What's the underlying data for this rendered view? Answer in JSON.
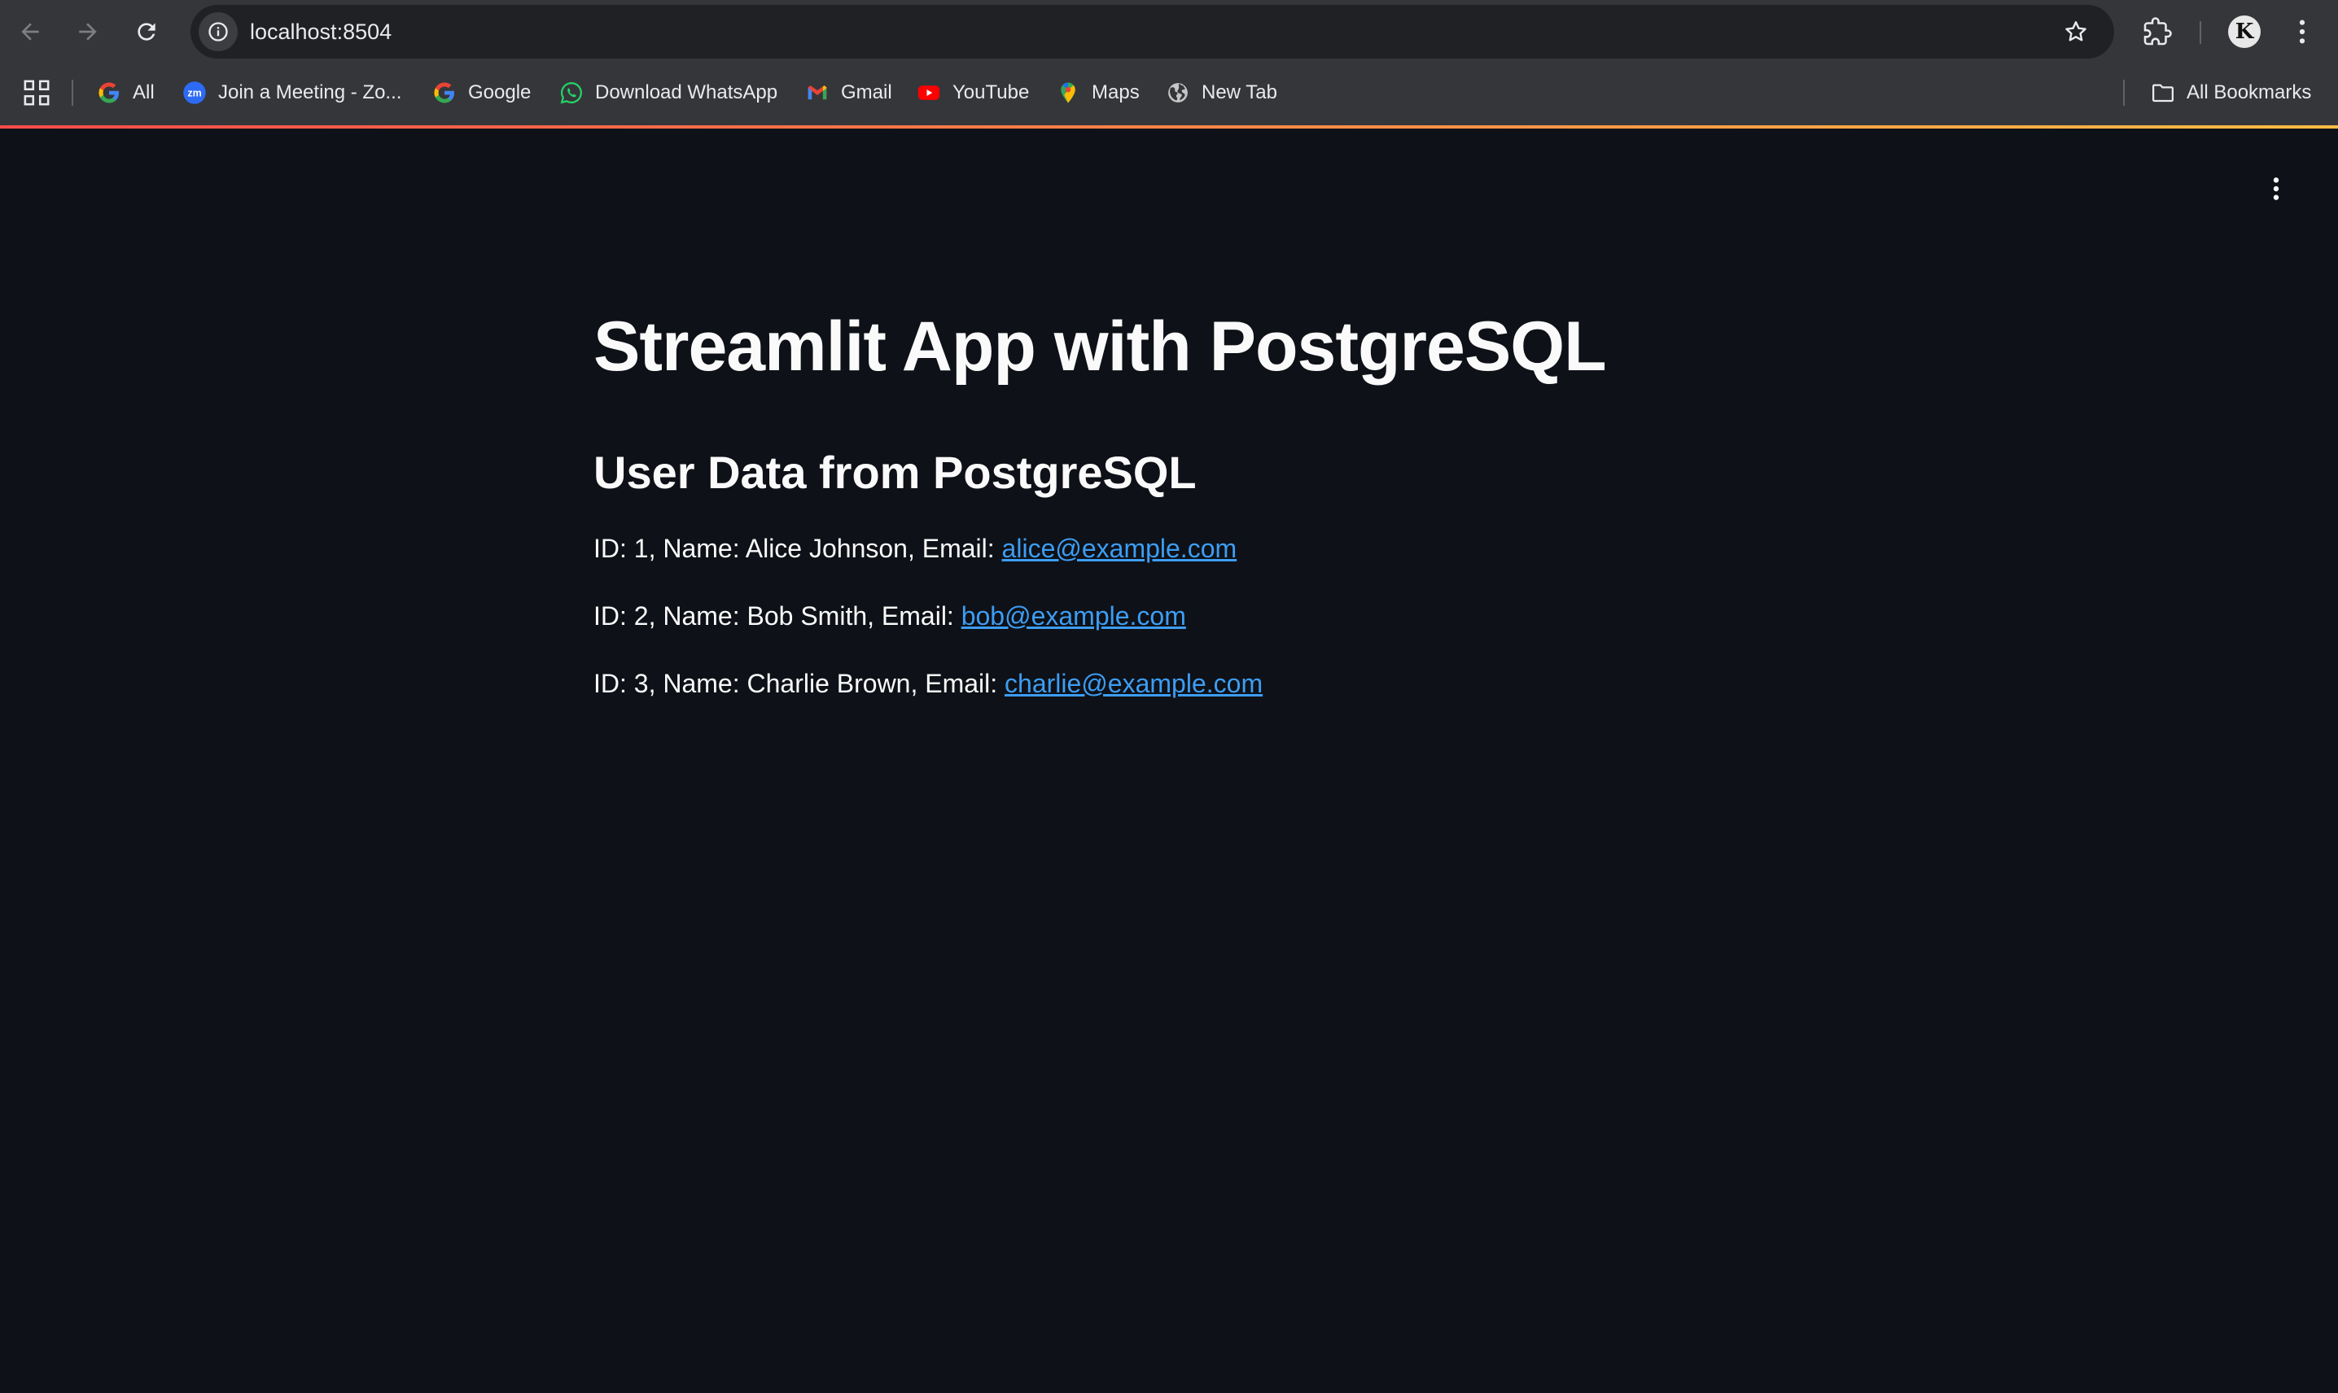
{
  "browser": {
    "url": "localhost:8504",
    "bookmarks": [
      {
        "label": "All",
        "icon": "google-icon"
      },
      {
        "label": "Join a Meeting - Zo...",
        "icon": "zoom-icon"
      },
      {
        "label": "Google",
        "icon": "google-icon"
      },
      {
        "label": "Download WhatsApp",
        "icon": "whatsapp-icon"
      },
      {
        "label": "Gmail",
        "icon": "gmail-icon"
      },
      {
        "label": "YouTube",
        "icon": "youtube-icon"
      },
      {
        "label": "Maps",
        "icon": "maps-pin-icon"
      },
      {
        "label": "New Tab",
        "icon": "globe-icon"
      }
    ],
    "all_bookmarks_label": "All Bookmarks",
    "avatar_letter": "K"
  },
  "app": {
    "title": "Streamlit App with PostgreSQL",
    "subheader": "User Data from PostgreSQL",
    "users": [
      {
        "prefix": "ID: 1, Name: Alice Johnson, Email: ",
        "email": "alice@example.com"
      },
      {
        "prefix": "ID: 2, Name: Bob Smith, Email: ",
        "email": "bob@example.com"
      },
      {
        "prefix": "ID: 3, Name: Charlie Brown, Email: ",
        "email": "charlie@example.com"
      }
    ]
  },
  "colors": {
    "app_background": "#0e1117",
    "text": "#fafafa",
    "link": "#3d9df3",
    "chrome_background": "#35363a",
    "decoration_start": "#ff4b4b",
    "decoration_end": "#ffbd45"
  }
}
